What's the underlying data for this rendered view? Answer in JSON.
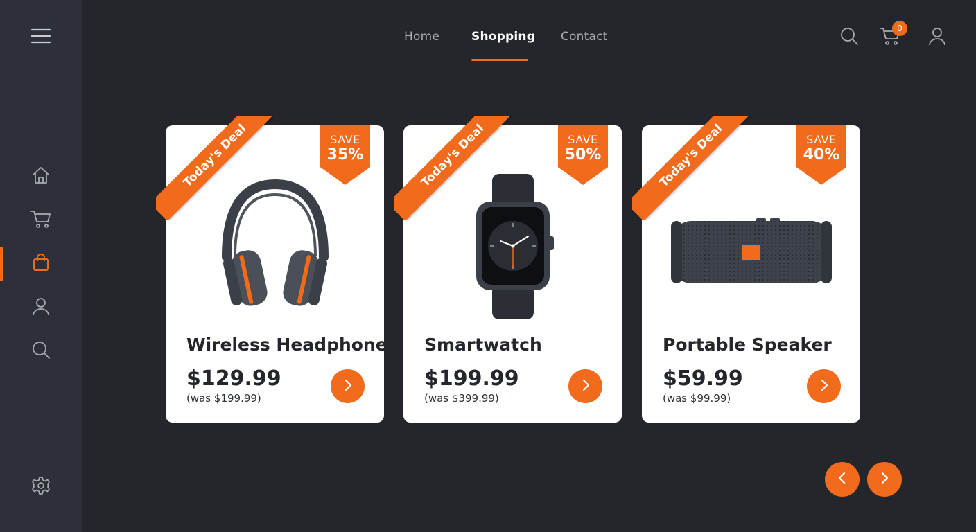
{
  "colors": {
    "accent": "#f26a1b",
    "background": "#24262b",
    "sidebar": "#2d3039",
    "card": "#ffffff"
  },
  "sidebar": {
    "menu_icon": "hamburger-icon",
    "items": [
      {
        "name": "home",
        "icon": "home-icon"
      },
      {
        "name": "cart",
        "icon": "cart-icon"
      },
      {
        "name": "shopping-bag",
        "icon": "bag-icon",
        "active": true
      },
      {
        "name": "profile",
        "icon": "user-icon"
      },
      {
        "name": "search",
        "icon": "search-icon"
      }
    ],
    "settings_icon": "gear-icon"
  },
  "nav": {
    "links": [
      {
        "label": "Home"
      },
      {
        "label": "Shopping",
        "active": true
      },
      {
        "label": "Contact"
      }
    ],
    "cart_count": "0"
  },
  "cards": [
    {
      "ribbon": "Today's Deal",
      "save_label": "SAVE",
      "save_pct": "35%",
      "title": "Wireless Headphone",
      "price": "$129.99",
      "was": "(was $199.99)",
      "image": "headphones"
    },
    {
      "ribbon": "Today's Deal",
      "save_label": "SAVE",
      "save_pct": "50%",
      "title": "Smartwatch",
      "price": "$199.99",
      "was": "(was $399.99)",
      "image": "smartwatch"
    },
    {
      "ribbon": "Today's Deal",
      "save_label": "SAVE",
      "save_pct": "40%",
      "title": "Portable Speaker",
      "price": "$59.99",
      "was": "(was $99.99)",
      "image": "portable-speaker"
    }
  ]
}
